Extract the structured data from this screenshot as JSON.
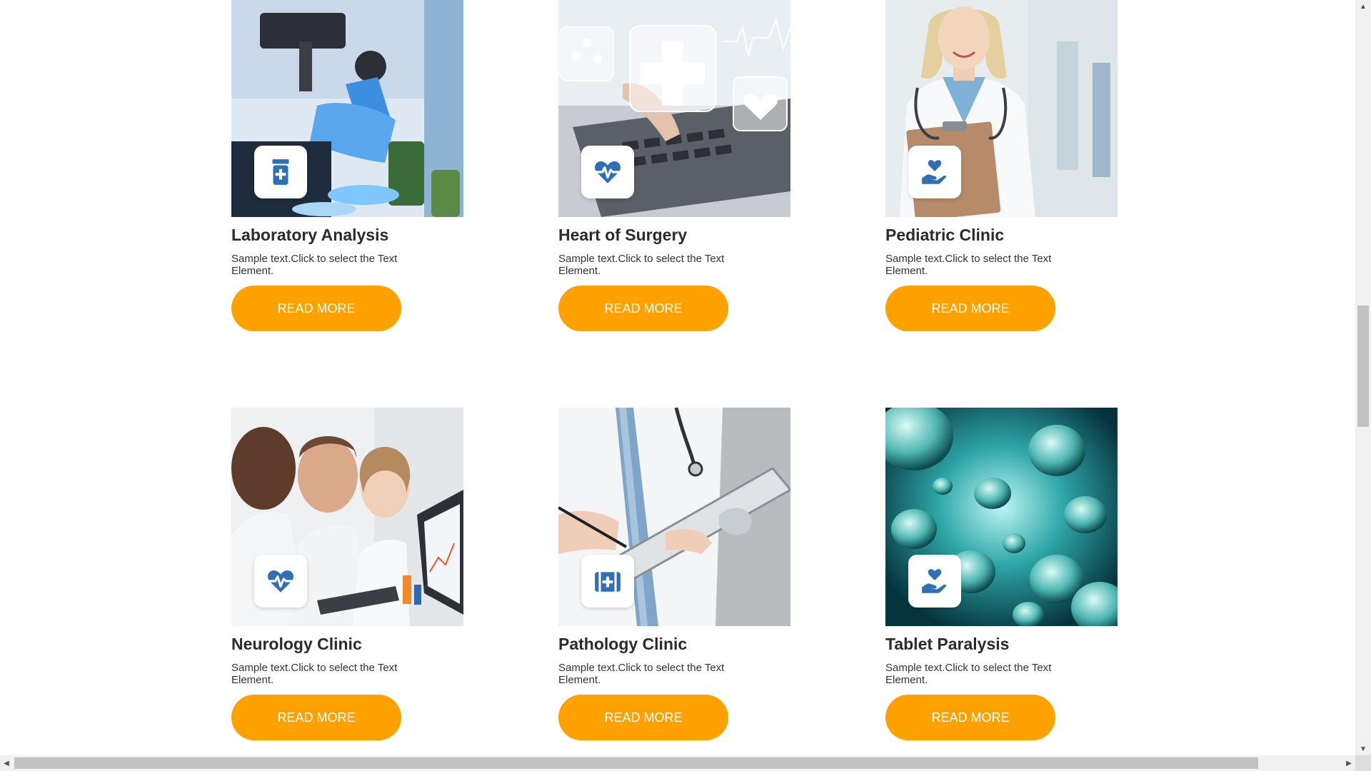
{
  "colors": {
    "accent_button": "#ffa200",
    "icon_blue": "#2f6fb3",
    "title_text": "#2b2b2b"
  },
  "cards": [
    {
      "title": "Laboratory Analysis",
      "text": "Sample text.Click to select the Text Element.",
      "button": "READ MORE",
      "icon": "medicine-bottle-icon",
      "image": "laboratory-photo"
    },
    {
      "title": "Heart of Surgery",
      "text": "Sample text.Click to select the Text Element.",
      "button": "READ MORE",
      "icon": "heart-pulse-icon",
      "image": "digital-health-laptop-photo"
    },
    {
      "title": "Pediatric Clinic",
      "text": "Sample text.Click to select the Text Element.",
      "button": "READ MORE",
      "icon": "hand-holding-heart-icon",
      "image": "doctor-clipboard-photo"
    },
    {
      "title": "Neurology Clinic",
      "text": "Sample text.Click to select the Text Element.",
      "button": "READ MORE",
      "icon": "heart-pulse-icon",
      "image": "doctors-computer-photo"
    },
    {
      "title": "Pathology Clinic",
      "text": "Sample text.Click to select the Text Element.",
      "button": "READ MORE",
      "icon": "medical-kit-icon",
      "image": "doctor-tablet-photo"
    },
    {
      "title": "Tablet Paralysis",
      "text": "Sample text.Click to select the Text Element.",
      "button": "READ MORE",
      "icon": "hand-holding-heart-icon",
      "image": "bacteria-photo"
    }
  ]
}
